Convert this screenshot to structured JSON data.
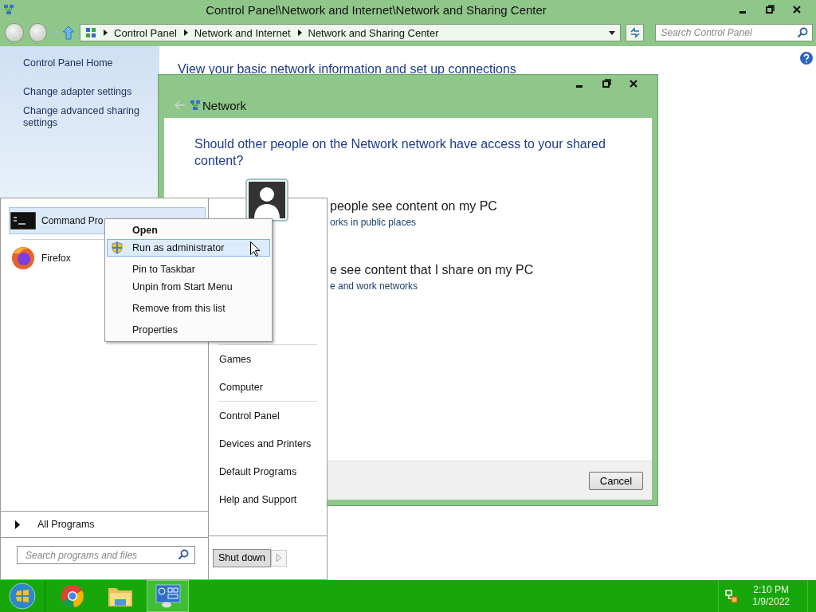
{
  "cp_window": {
    "title": "Control Panel\\Network and Internet\\Network and Sharing Center",
    "breadcrumb": [
      "Control Panel",
      "Network and Internet",
      "Network and Sharing Center"
    ],
    "search": {
      "placeholder": "Search Control Panel"
    },
    "sidebar": {
      "items": [
        "Control Panel Home",
        "Change adapter settings",
        "Change advanced sharing settings"
      ]
    },
    "heading": "View your basic network information and set up connections"
  },
  "dialog": {
    "title": "Network",
    "question": "Should other people on the Network network have access to your shared content?",
    "options": [
      {
        "title": "people see content on my PC",
        "description": "orks in public places"
      },
      {
        "title": "e see content that I share on my PC",
        "description": "e and work networks"
      }
    ],
    "buttons": [
      "Cancel"
    ]
  },
  "start_menu": {
    "pinned": [
      {
        "label": "Command Pro",
        "kind": "console",
        "selected": true
      },
      {
        "label": "Firefox",
        "kind": "browser",
        "selected": false
      }
    ],
    "all_programs": "All Programs",
    "search": {
      "placeholder": "Search programs and files"
    },
    "link_groups": [
      [
        "Games",
        "Computer"
      ],
      [
        "Control Panel",
        "Devices and Printers",
        "Default Programs",
        "Help and Support"
      ]
    ],
    "shutdown": "Shut down"
  },
  "context_menu": {
    "items": [
      {
        "label": "Open",
        "kind": "default",
        "selected": false
      },
      {
        "label": "Run as administrator",
        "kind": "elevated",
        "selected": true
      },
      {
        "label": "Pin to Taskbar",
        "kind": "plain",
        "selected": false
      },
      {
        "label": "Unpin from Start Menu",
        "kind": "plain",
        "selected": false
      },
      {
        "label": "Remove from this list",
        "kind": "plain",
        "selected": false
      },
      {
        "label": "Properties",
        "kind": "plain",
        "selected": false
      }
    ]
  },
  "taskbar": {
    "apps": [
      {
        "kind": "chrome",
        "selected": false
      },
      {
        "kind": "explorer",
        "selected": false
      },
      {
        "kind": "control-panel",
        "selected": true
      }
    ],
    "time": "2:10 PM",
    "date": "1/9/2022"
  }
}
